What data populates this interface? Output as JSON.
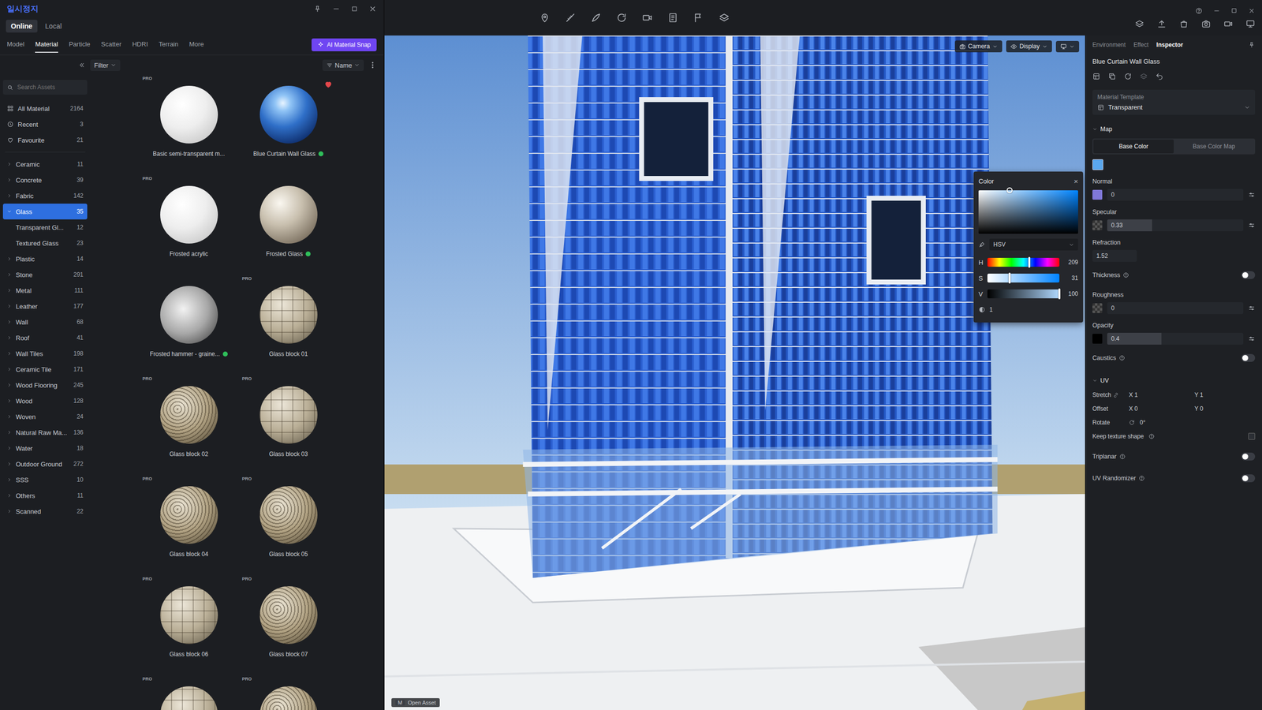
{
  "window": {
    "title": "일시정지"
  },
  "library": {
    "source_tabs": [
      {
        "label": "Online",
        "selected": true
      },
      {
        "label": "Local",
        "selected": false
      }
    ],
    "tabs": [
      {
        "label": "Model",
        "selected": false
      },
      {
        "label": "Material",
        "selected": true
      },
      {
        "label": "Particle",
        "selected": false
      },
      {
        "label": "Scatter",
        "selected": false
      },
      {
        "label": "HDRI",
        "selected": false
      },
      {
        "label": "Terrain",
        "selected": false
      },
      {
        "label": "More",
        "selected": false
      }
    ],
    "ai_button": "AI Material Snap",
    "filter": "Filter",
    "sort": "Name",
    "search": {
      "placeholder": "Search Assets"
    },
    "quick": [
      {
        "label": "All Material",
        "count": "2164"
      },
      {
        "label": "Recent",
        "count": "3"
      },
      {
        "label": "Favourite",
        "count": "21"
      }
    ],
    "categories": [
      {
        "label": "Ceramic",
        "count": "11",
        "kind": "category",
        "expanded": false,
        "selected": false
      },
      {
        "label": "Concrete",
        "count": "39",
        "kind": "category",
        "expanded": false,
        "selected": false
      },
      {
        "label": "Fabric",
        "count": "142",
        "kind": "category",
        "expanded": false,
        "selected": false
      },
      {
        "label": "Glass",
        "count": "35",
        "kind": "category",
        "expanded": true,
        "selected": true
      },
      {
        "label": "Transparent Gl...",
        "count": "12",
        "kind": "subcategory",
        "expanded": false,
        "selected": false
      },
      {
        "label": "Textured Glass",
        "count": "23",
        "kind": "subcategory",
        "expanded": false,
        "selected": false
      },
      {
        "label": "Plastic",
        "count": "14",
        "kind": "category",
        "expanded": false,
        "selected": false
      },
      {
        "label": "Stone",
        "count": "291",
        "kind": "category",
        "expanded": false,
        "selected": false
      },
      {
        "label": "Metal",
        "count": "111",
        "kind": "category",
        "expanded": false,
        "selected": false
      },
      {
        "label": "Leather",
        "count": "177",
        "kind": "category",
        "expanded": false,
        "selected": false
      },
      {
        "label": "Wall",
        "count": "68",
        "kind": "category",
        "expanded": false,
        "selected": false
      },
      {
        "label": "Roof",
        "count": "41",
        "kind": "category",
        "expanded": false,
        "selected": false
      },
      {
        "label": "Wall Tiles",
        "count": "198",
        "kind": "category",
        "expanded": false,
        "selected": false
      },
      {
        "label": "Ceramic Tile",
        "count": "171",
        "kind": "category",
        "expanded": false,
        "selected": false
      },
      {
        "label": "Wood Flooring",
        "count": "245",
        "kind": "category",
        "expanded": false,
        "selected": false
      },
      {
        "label": "Wood",
        "count": "128",
        "kind": "category",
        "expanded": false,
        "selected": false
      },
      {
        "label": "Woven",
        "count": "24",
        "kind": "category",
        "expanded": false,
        "selected": false
      },
      {
        "label": "Natural Raw Ma...",
        "count": "136",
        "kind": "category",
        "expanded": false,
        "selected": false
      },
      {
        "label": "Water",
        "count": "18",
        "kind": "category",
        "expanded": false,
        "selected": false
      },
      {
        "label": "Outdoor Ground",
        "count": "272",
        "kind": "category",
        "expanded": false,
        "selected": false
      },
      {
        "label": "SSS",
        "count": "10",
        "kind": "category",
        "expanded": false,
        "selected": false
      },
      {
        "label": "Others",
        "count": "11",
        "kind": "category",
        "expanded": false,
        "selected": false
      },
      {
        "label": "Scanned",
        "count": "22",
        "kind": "category",
        "expanded": false,
        "selected": false
      }
    ],
    "pro_label": "PRO",
    "materials": [
      {
        "name": "Basic semi-transparent m...",
        "pro": true,
        "downloaded": false,
        "favourite": false,
        "kind": "white"
      },
      {
        "name": "Blue Curtain Wall Glass",
        "pro": false,
        "downloaded": true,
        "favourite": true,
        "kind": "blue"
      },
      {
        "name": "Frosted acrylic",
        "pro": true,
        "downloaded": false,
        "favourite": false,
        "kind": "white"
      },
      {
        "name": "Frosted Glass",
        "pro": false,
        "downloaded": true,
        "favourite": false,
        "kind": "frosted"
      },
      {
        "name": "Frosted hammer - graine...",
        "pro": false,
        "downloaded": true,
        "favourite": false,
        "kind": "hammer"
      },
      {
        "name": "Glass block 01",
        "pro": true,
        "downloaded": false,
        "favourite": false,
        "kind": "block"
      },
      {
        "name": "Glass block 02",
        "pro": true,
        "downloaded": false,
        "favourite": false,
        "kind": "pattern"
      },
      {
        "name": "Glass block 03",
        "pro": true,
        "downloaded": false,
        "favourite": false,
        "kind": "block"
      },
      {
        "name": "Glass block 04",
        "pro": true,
        "downloaded": false,
        "favourite": false,
        "kind": "pattern"
      },
      {
        "name": "Glass block 05",
        "pro": true,
        "downloaded": false,
        "favourite": false,
        "kind": "pattern"
      },
      {
        "name": "Glass block 06",
        "pro": true,
        "downloaded": false,
        "favourite": false,
        "kind": "block"
      },
      {
        "name": "Glass block 07",
        "pro": true,
        "downloaded": false,
        "favourite": false,
        "kind": "pattern"
      },
      {
        "name": "",
        "pro": true,
        "downloaded": false,
        "favourite": false,
        "kind": "block"
      },
      {
        "name": "",
        "pro": true,
        "downloaded": false,
        "favourite": false,
        "kind": "pattern"
      }
    ]
  },
  "viewport": {
    "camera": "Camera",
    "display": "Display",
    "open_asset": {
      "key": "M",
      "label": "Open Asset"
    }
  },
  "color_picker": {
    "title": "Color",
    "close": "×",
    "mode": "HSV",
    "channels": [
      {
        "name": "H",
        "value": "209",
        "level": 0.58
      },
      {
        "name": "S",
        "value": "31",
        "level": 0.31
      },
      {
        "name": "V",
        "value": "100",
        "level": 1
      }
    ],
    "alpha": "1"
  },
  "inspector": {
    "tabs": [
      {
        "label": "Environment",
        "selected": false
      },
      {
        "label": "Effect",
        "selected": false
      },
      {
        "label": "Inspector",
        "selected": true
      }
    ],
    "material_name": "Blue Curtain Wall Glass",
    "template": {
      "label": "Material Template",
      "value": "Transparent"
    },
    "map": {
      "title": "Map",
      "modes": [
        {
          "label": "Base Color",
          "selected": true
        },
        {
          "label": "Base Color Map",
          "selected": false
        }
      ],
      "base_color": "#5aa7ee"
    },
    "params": [
      {
        "kind": "slider",
        "label": "Normal",
        "value": "0",
        "level": 0,
        "swatch": "#8078d8"
      },
      {
        "kind": "slider",
        "label": "Specular",
        "value": "0.33",
        "level": 0.33,
        "swatch": "checker"
      },
      {
        "kind": "value",
        "label": "Refraction",
        "value": "1.52"
      },
      {
        "kind": "toggle",
        "label": "Thickness",
        "on": false
      },
      {
        "kind": "slider",
        "label": "Roughness",
        "value": "0",
        "level": 0,
        "swatch": "checker"
      },
      {
        "kind": "slider",
        "label": "Opacity",
        "value": "0.4",
        "level": 0.4,
        "swatch": "#000000"
      },
      {
        "kind": "toggle",
        "label": "Caustics",
        "on": false
      }
    ],
    "uv": {
      "title": "UV",
      "rows": [
        {
          "kind": "pair",
          "label": "Stretch",
          "a": "X 1",
          "b": "Y 1"
        },
        {
          "kind": "pair",
          "label": "Offset",
          "a": "X 0",
          "b": "Y 0"
        },
        {
          "kind": "angle",
          "label": "Rotate",
          "value": "0°"
        },
        {
          "kind": "check",
          "label": "Keep texture shape",
          "checked": false
        },
        {
          "kind": "toggle",
          "label": "Triplanar",
          "on": false
        },
        {
          "kind": "toggle",
          "label": "UV Randomizer",
          "on": false
        }
      ]
    }
  }
}
